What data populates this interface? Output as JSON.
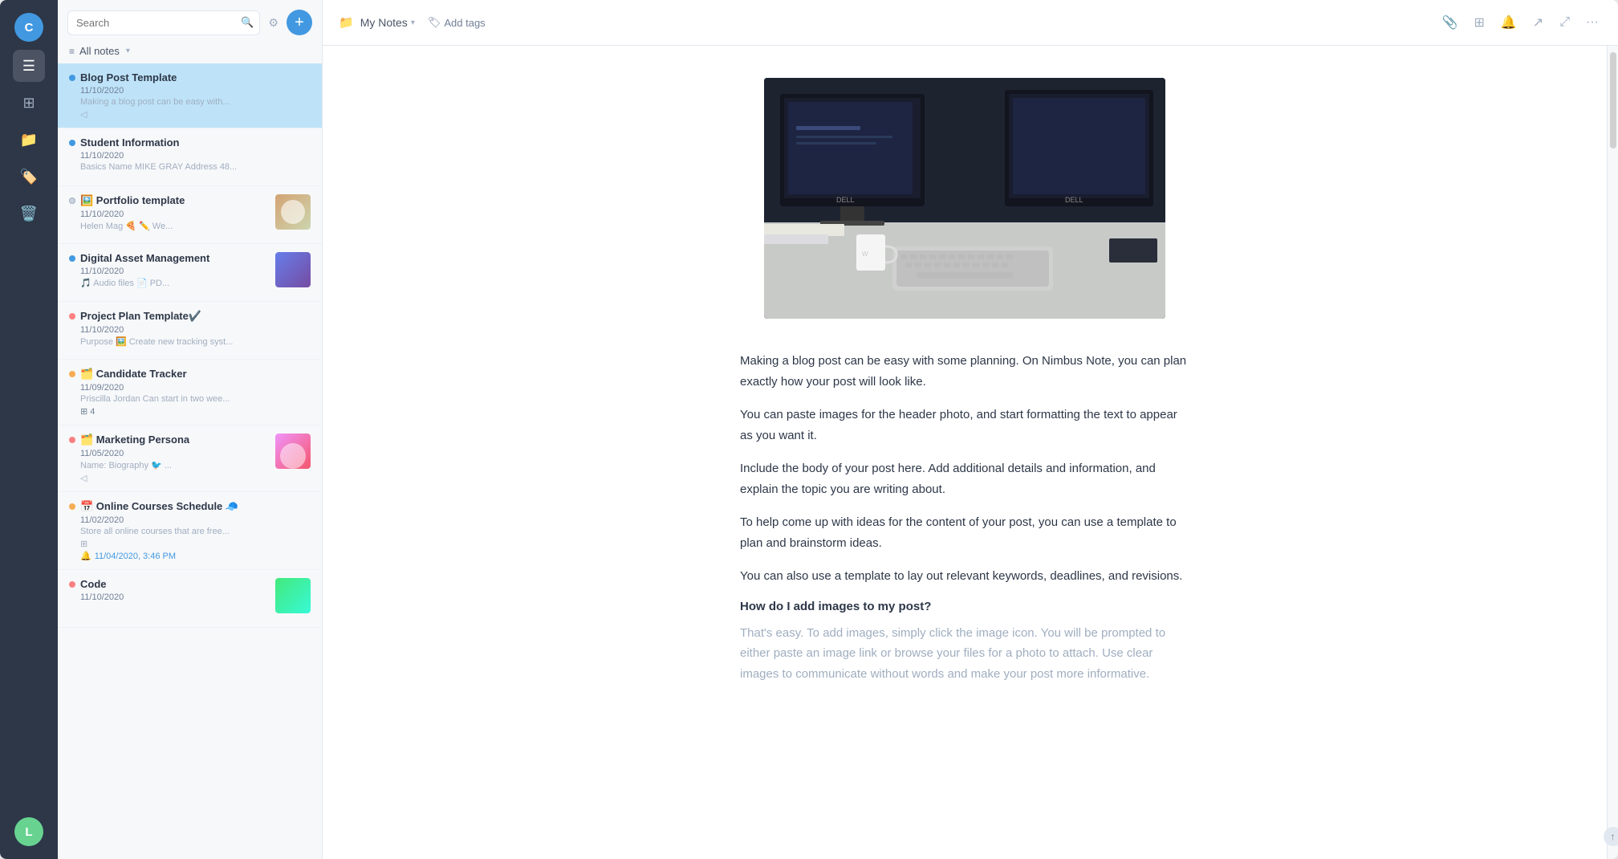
{
  "app": {
    "title": "Nimbus Note"
  },
  "iconBar": {
    "user_top_initial": "C",
    "user_bottom_initial": "L",
    "icons": [
      "☰",
      "⊞",
      "📁",
      "🏷️",
      "🗑️"
    ]
  },
  "search": {
    "placeholder": "Search",
    "value": ""
  },
  "allNotes": {
    "label": "All notes"
  },
  "breadcrumb": {
    "folder_icon": "📁",
    "folder_name": "My Notes",
    "chevron": "▾",
    "tag_icon": "🏷",
    "tag_label": "Add tags"
  },
  "toolbar": {
    "attach_icon": "📎",
    "grid_icon": "⊞",
    "bell_icon": "🔔",
    "share_icon": "↗",
    "expand_icon": "⤢",
    "more_icon": "···"
  },
  "notes": [
    {
      "id": "blog-post-template",
      "title": "Blog Post Template",
      "date": "11/10/2020",
      "preview": "Making a blog post can be easy with...",
      "dot_color": "blue",
      "active": true,
      "has_thumb": false,
      "has_share": true,
      "emoji": ""
    },
    {
      "id": "student-information",
      "title": "Student Information",
      "date": "11/10/2020",
      "preview": "Basics Name MIKE GRAY Address 48...",
      "dot_color": "blue",
      "active": false,
      "has_thumb": false,
      "has_share": false,
      "emoji": ""
    },
    {
      "id": "portfolio-template",
      "title": "Portfolio template",
      "date": "11/10/2020",
      "preview": "Helen Mag 🍕 ✏️ We...",
      "dot_color": "gray",
      "active": false,
      "has_thumb": true,
      "thumb_bg": "linear-gradient(135deg, #d4a373, #ccd5ae)",
      "has_share": false,
      "emoji": "🖼️"
    },
    {
      "id": "digital-asset-management",
      "title": "Digital Asset Management",
      "date": "11/10/2020",
      "preview": "🎵 Audio files 📄 PD...",
      "dot_color": "blue",
      "active": false,
      "has_thumb": true,
      "thumb_bg": "linear-gradient(135deg, #667eea, #764ba2)",
      "has_share": false,
      "emoji": ""
    },
    {
      "id": "project-plan-template",
      "title": "Project Plan Template✔️",
      "date": "11/10/2020",
      "preview": "Purpose 🖼️ Create new tracking syst...",
      "dot_color": "red",
      "active": false,
      "has_thumb": false,
      "has_share": false,
      "emoji": ""
    },
    {
      "id": "candidate-tracker",
      "title": "🗂️ Candidate Tracker",
      "date": "11/09/2020",
      "preview": "Priscilla Jordan Can start in two wee...",
      "dot_color": "orange",
      "active": false,
      "has_thumb": false,
      "has_share": false,
      "count": "4",
      "emoji": ""
    },
    {
      "id": "marketing-persona",
      "title": "🗂️ Marketing Persona",
      "date": "11/05/2020",
      "preview": "Name: Biography 🐦 ...",
      "dot_color": "red",
      "active": false,
      "has_thumb": true,
      "thumb_bg": "linear-gradient(135deg, #f093fb, #f5576c)",
      "has_share": true,
      "emoji": ""
    },
    {
      "id": "online-courses-schedule",
      "title": "📅 Online Courses Schedule 🧢",
      "date": "11/02/2020",
      "preview": "Store all online courses that are free...",
      "dot_color": "orange",
      "active": false,
      "has_thumb": false,
      "has_share": false,
      "shared_date": "🔔 11/04/2020, 3:46 PM",
      "emoji": ""
    },
    {
      "id": "code",
      "title": "Code",
      "date": "11/10/2020",
      "preview": "",
      "dot_color": "red",
      "active": false,
      "has_thumb": true,
      "thumb_bg": "linear-gradient(135deg, #43e97b, #38f9d7)",
      "has_share": false,
      "emoji": ""
    }
  ],
  "noteContent": {
    "paragraphs": [
      "Making a blog post can be easy with some planning. On Nimbus Note, you can plan exactly how your post will look like.",
      "You can paste images for the header photo, and start formatting the text to appear as you want it.",
      "Include the body of your post here. Add additional details and information, and explain the topic you are writing about.",
      "To help come up with ideas for the content of your post, you can use a template to plan and brainstorm ideas.",
      "You can also use a template to lay out relevant keywords, deadlines, and revisions."
    ],
    "heading": "How do I add images to my post?",
    "faded_text": "That's easy. To add images, simply click the image icon. You will be prompted to either paste an image link or browse your files for a photo to attach. Use clear images to communicate without words and make your post more informative."
  }
}
